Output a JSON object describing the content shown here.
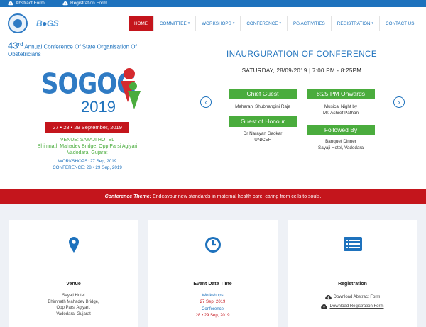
{
  "topbar": {
    "abstract_form": "Abstract Form",
    "registration_form": "Registration Form"
  },
  "header": {
    "logo_text_a": "B",
    "logo_text_b": "GS"
  },
  "nav": {
    "home": "HOME",
    "committee": "COMMITTEE",
    "workshops": "WORKSHOPS",
    "conference": "CONFERENCE",
    "pg_activities": "PG ACTIVITIES",
    "registration": "REGISTRATION",
    "contact_us": "CONTACT US"
  },
  "hero": {
    "ordinal_num": "43",
    "ordinal_suffix": "rd",
    "title_line1": "Annual Conference Of State Organisation Of",
    "title_line2": "Obstetricians",
    "brand_word": "SOGOG",
    "brand_year": "2019",
    "date_badge": "27 • 28 • 29 September, 2019",
    "venue_line1": "VENUE: SAYAJI HOTEL",
    "venue_line2": "Bhimnath Mahadev Bridge, Opp Parsi Agiyari",
    "venue_line3": "Vadodara, Gujarat",
    "workshops_line": "WORKSHOPS: 27 Sep, 2019",
    "conference_line": "CONFERENCE: 28 • 29 Sep, 2019",
    "prev_arrow": "‹",
    "next_arrow": "›"
  },
  "slide": {
    "heading": "INAURGURATION OF CONFERENCE",
    "date": "SATURDAY, 28/09/2019 | 7:00 PM - 8:25PM",
    "chief_guest_label": "Chief Guest",
    "chief_guest_name": "Maharani Shubhangini Raje",
    "onwards_label": "8:25 PM Onwards",
    "onwards_line1": "Musical Night by",
    "onwards_line2": "Mr. Ashref Pathan",
    "honour_label": "Guest of Honour",
    "honour_line1": "Dr Narayan Gaokar",
    "honour_line2": "UNICEF",
    "followed_label": "Followed By",
    "followed_line1": "Banquet Dinner",
    "followed_line2": "Sayaji Hotel, Vadodara"
  },
  "theme": {
    "label": "Conference Theme:",
    "text": "Endeavour new standards in maternal health care: caring from cells to souls."
  },
  "cards": {
    "venue_title": "Venue",
    "venue_line1": "Sayaji Hotel",
    "venue_line2": "Bhimnath Mahadev Bridge,",
    "venue_line3": "Opp Parsi Agiyari,",
    "venue_line4": "Vadodara, Gujarat",
    "event_title": "Event Date Time",
    "event_workshops_label": "Workshops",
    "event_workshops_date": "27 Sep, 2019",
    "event_conference_label": "Conference",
    "event_conference_date": "28 • 29 Sep, 2019",
    "reg_title": "Registration",
    "reg_abstract": "Download Abstract Form",
    "reg_registration": "Download Registration Form"
  },
  "colors": {
    "brand_blue": "#1e72bd",
    "brand_red": "#c4151c",
    "brand_green": "#4aac3d"
  }
}
